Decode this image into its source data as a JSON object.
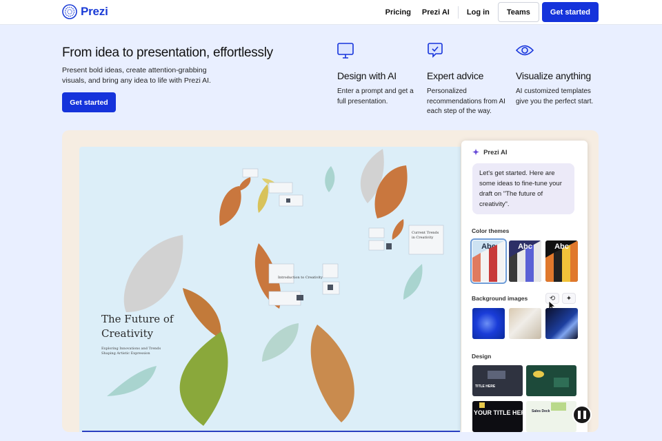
{
  "header": {
    "brand": "Prezi",
    "nav": [
      "Pricing",
      "Prezi AI",
      "Log in"
    ],
    "teams_label": "Teams",
    "cta_label": "Get started"
  },
  "hero": {
    "title": "From idea to presentation, effortlessly",
    "description": "Present bold ideas, create attention-grabbing visuals, and bring any idea to life with Prezi AI.",
    "cta_label": "Get started"
  },
  "features": [
    {
      "icon": "monitor-icon",
      "title": "Design with AI",
      "description": "Enter a prompt and get a full presentation."
    },
    {
      "icon": "chat-check-icon",
      "title": "Expert advice",
      "description": "Personalized recommendations from AI each step of the way."
    },
    {
      "icon": "eye-icon",
      "title": "Visualize anything",
      "description": "AI customized templates give you the perfect start."
    }
  ],
  "canvas": {
    "title": "The Future of Creativity",
    "subtitle": "Exploring Innovations and Trends Shaping Artistic Expression",
    "topic_intro": "Introduction to Creativity",
    "topic_trends": "Current Trends in Creativity"
  },
  "ai_panel": {
    "title": "Prezi AI",
    "message": "Let's get started. Here are some ideas to fine-tune your draft on \"The future of creativity\".",
    "color_themes_label": "Color themes",
    "themes": [
      "Abc",
      "Abc",
      "Abc"
    ],
    "background_images_label": "Background images",
    "design_label": "Design",
    "design_texts": [
      "TITLE HERE",
      "YOUR TITLE HER",
      "Sales Deck"
    ]
  },
  "colors": {
    "brand": "#1533db",
    "page_bg": "#e9efff",
    "canvas_bg": "#dceef8",
    "demo_bg": "#f6ede2"
  }
}
